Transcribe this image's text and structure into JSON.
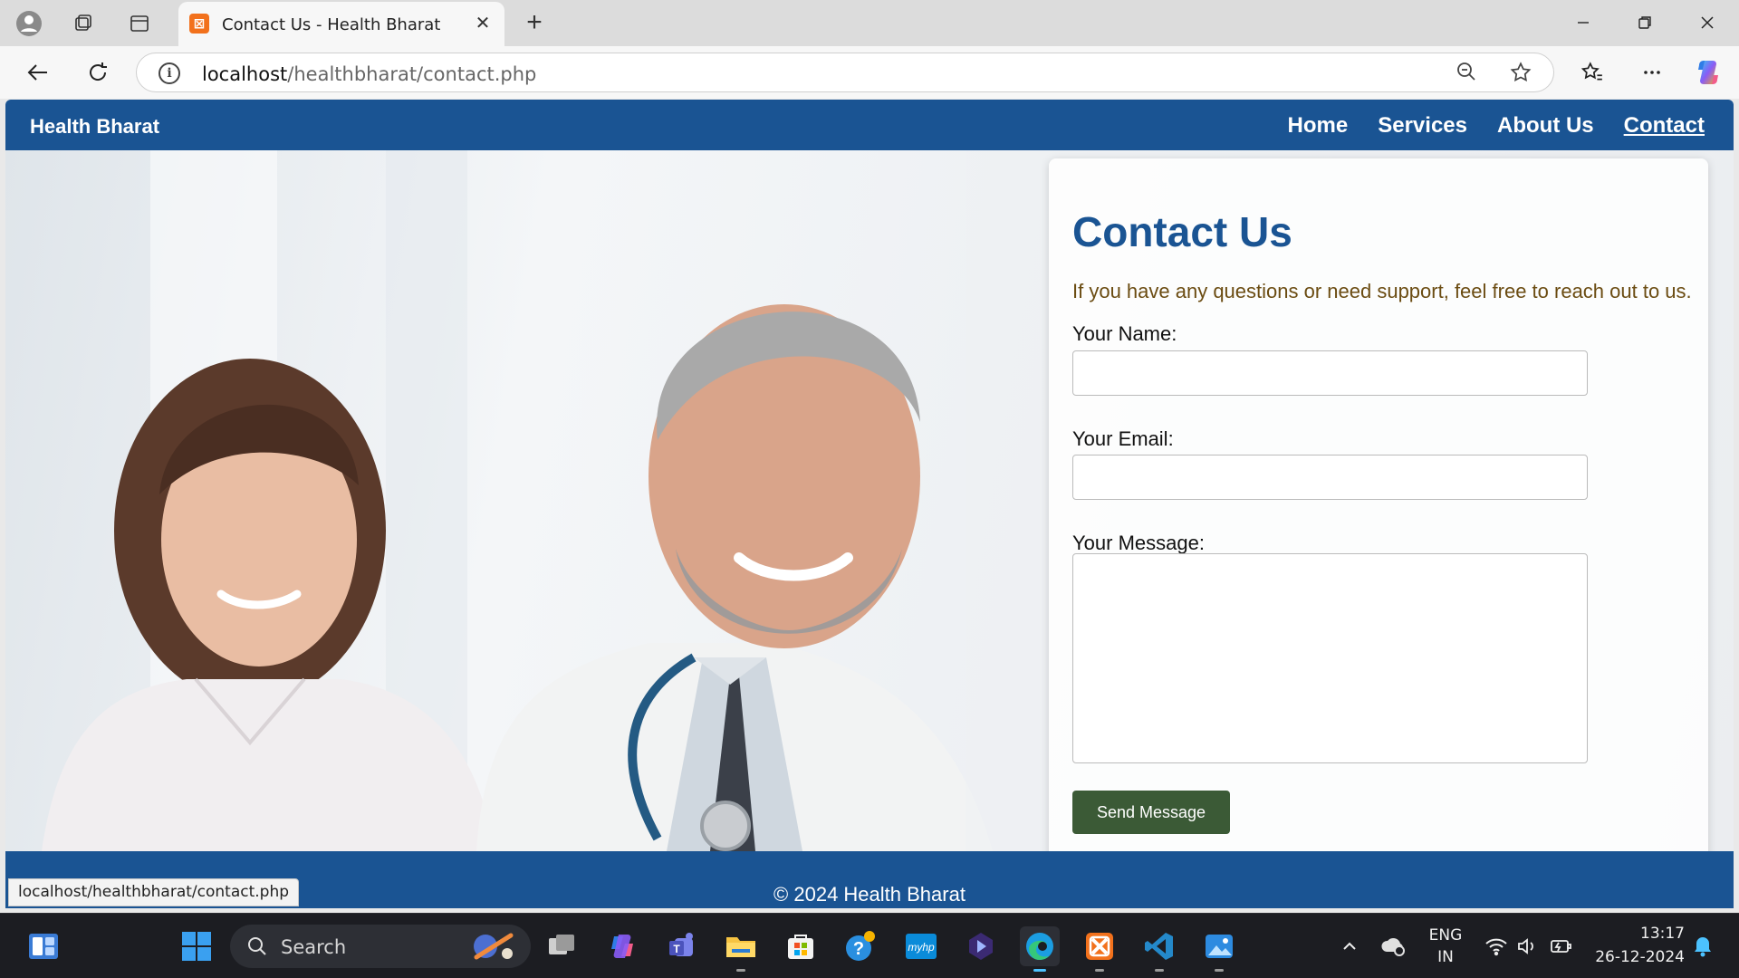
{
  "browser": {
    "tab_title": "Contact Us - Health Bharat",
    "url_host": "localhost",
    "url_path": "/healthbharat/contact.php",
    "status_url": "localhost/healthbharat/contact.php"
  },
  "site": {
    "brand": "Health Bharat",
    "nav": [
      {
        "label": "Home",
        "active": false
      },
      {
        "label": "Services",
        "active": false
      },
      {
        "label": "About Us",
        "active": false
      },
      {
        "label": "Contact",
        "active": true
      }
    ],
    "colors": {
      "nav_bg": "#1a5493",
      "title": "#1a5493",
      "intro": "#6b4c12",
      "button": "#3b5a36"
    }
  },
  "contact": {
    "title": "Contact Us",
    "intro": "If you have any questions or need support, feel free to reach out to us.",
    "name_label": "Your Name:",
    "email_label": "Your Email:",
    "message_label": "Your Message:",
    "name_value": "",
    "email_value": "",
    "message_value": "",
    "submit_label": "Send Message"
  },
  "footer": {
    "copyright": "© 2024 Health Bharat"
  },
  "taskbar": {
    "search_placeholder": "Search",
    "language": "ENG",
    "region": "IN",
    "time": "13:17",
    "date": "26-12-2024"
  }
}
